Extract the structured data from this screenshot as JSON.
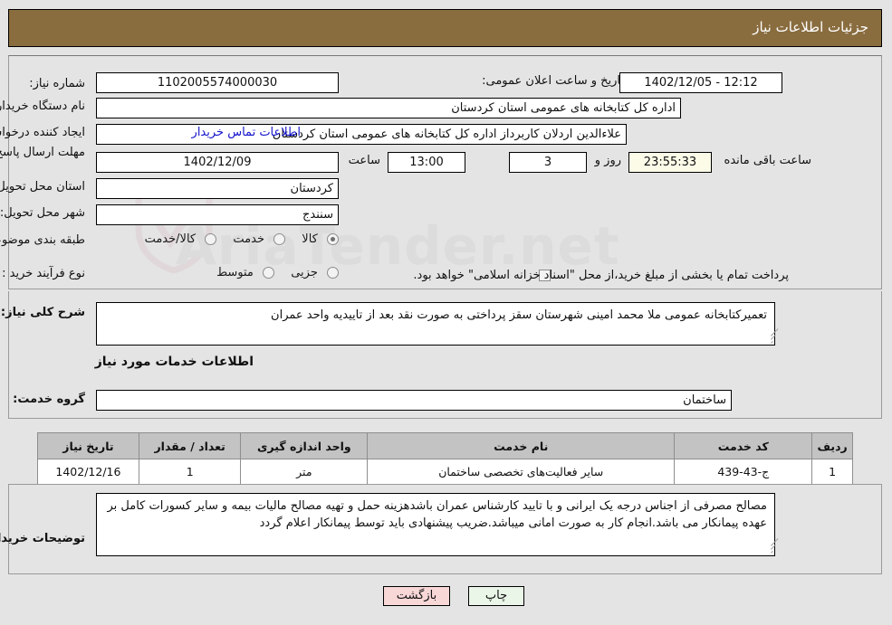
{
  "header": {
    "title": "جزئیات اطلاعات نیاز"
  },
  "info": {
    "need_number_label": "شماره نیاز:",
    "need_number_value": "1102005574000030",
    "announce_datetime_label": "تاریخ و ساعت اعلان عمومی:",
    "announce_datetime_value": "1402/12/05 - 12:12",
    "buyer_org_label": "نام دستگاه خریدار:",
    "buyer_org_value": "اداره کل کتابخانه های عمومی استان کردستان",
    "requester_label": "ایجاد کننده درخواست:",
    "requester_value": "علاءالدین اردلان کاربرداز اداره کل کتابخانه های عمومی استان کردستان",
    "contact_link": "اطلاعات تماس خریدار",
    "deadline_label": "مهلت ارسال پاسخ: تا تاریخ:",
    "deadline_date": "1402/12/09",
    "deadline_hour_label": "ساعت",
    "deadline_hour_value": "13:00",
    "remaining_days_value": "3",
    "remaining_days_label": "روز و",
    "remaining_time_value": "23:55:33",
    "remaining_time_label": "ساعت باقی مانده",
    "delivery_province_label": "استان محل تحویل:",
    "delivery_province_value": "کردستان",
    "delivery_city_label": "شهر محل تحویل:",
    "delivery_city_value": "سنندج",
    "category_label": "طبقه بندی موضوعی:",
    "category_options": [
      {
        "label": "کالا",
        "selected": true
      },
      {
        "label": "خدمت",
        "selected": false
      },
      {
        "label": "کالا/خدمت",
        "selected": false
      }
    ],
    "purchase_type_label": "نوع فرآیند خرید :",
    "purchase_type_options": [
      {
        "label": "جزیی",
        "selected": false
      },
      {
        "label": "متوسط",
        "selected": false
      }
    ],
    "treasury_checkbox_label": "پرداخت تمام یا بخشی از مبلغ خرید،از محل \"اسناد خزانه اسلامی\" خواهد بود.",
    "treasury_checked": false
  },
  "description": {
    "label": "شرح کلی نیاز:",
    "value": "تعمیرکتابخانه عمومی ملا محمد امینی شهرستان سقز پرداختی به صورت نقد بعد از تاییدیه واحد عمران"
  },
  "services": {
    "section_title": "اطلاعات خدمات مورد نیاز",
    "group_label": "گروه خدمت:",
    "group_value": "ساختمان",
    "columns": [
      "ردیف",
      "کد خدمت",
      "نام خدمت",
      "واحد اندازه گیری",
      "تعداد / مقدار",
      "تاریخ نیاز"
    ],
    "rows": [
      {
        "index": "1",
        "code": "ج-43-439",
        "name": "سایر فعالیت‌های تخصصی ساختمان",
        "unit": "متر",
        "quantity": "1",
        "need_date": "1402/12/16"
      }
    ]
  },
  "notes": {
    "label": "توضیحات خریدار:",
    "value": "مصالح مصرفی از اجناس درجه یک ایرانی و با تایید کارشناس عمران باشدهزینه حمل و تهیه مصالح مالیات بیمه و سایر کسورات کامل بر عهده پیمانکار می باشد.انجام کار به صورت امانی میباشد.ضریب پیشنهادی باید توسط پیمانکار اعلام گردد"
  },
  "footer": {
    "print_label": "چاپ",
    "back_label": "بازگشت"
  },
  "watermark": {
    "text": "AriaTender.net",
    "shield_icon": "shield-icon"
  },
  "colors": {
    "header_bg": "#8a6d3f",
    "link": "#1414cc",
    "table_header_bg": "#c3c3c3",
    "print_btn_bg": "#eaf7e8",
    "back_btn_bg": "#f8d7d7",
    "countdown_bg": "#fbfbe8"
  }
}
